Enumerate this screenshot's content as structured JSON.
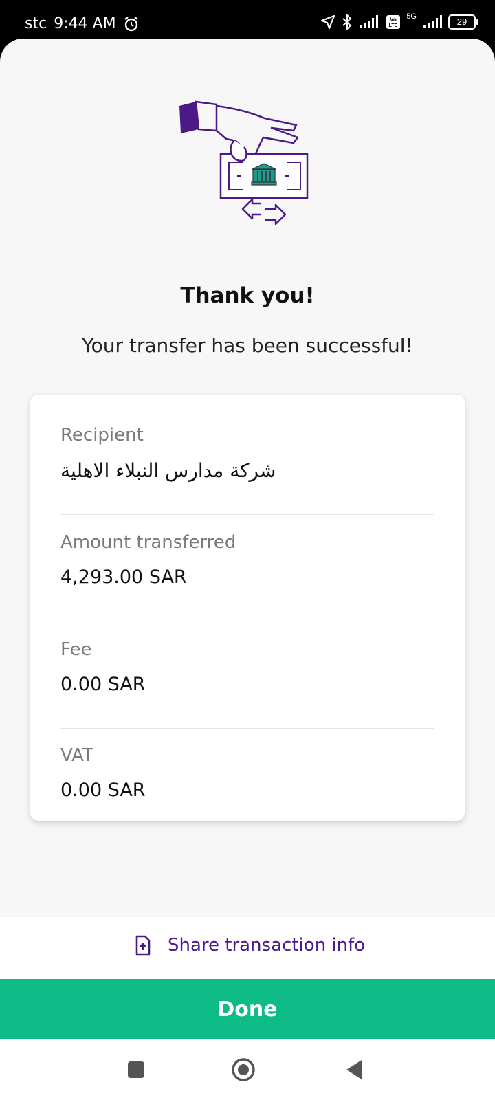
{
  "status_bar": {
    "carrier": "stc",
    "time": "9:44 AM",
    "battery": "29",
    "network": "5G"
  },
  "confirmation": {
    "title": "Thank you!",
    "subtitle": "Your transfer has been successful!"
  },
  "details": [
    {
      "label": "Recipient",
      "value": "شركة مدارس النبلاء الاهلية"
    },
    {
      "label": "Amount transferred",
      "value": "4,293.00 SAR"
    },
    {
      "label": "Fee",
      "value": "0.00 SAR"
    },
    {
      "label": "VAT",
      "value": "0.00 SAR"
    }
  ],
  "actions": {
    "share_label": "Share transaction info",
    "done_label": "Done"
  },
  "colors": {
    "accent": "#4b1a86",
    "done": "#0dbb86",
    "bank_teal": "#1f9b8f"
  },
  "icons": {
    "alarm": "alarm-icon",
    "location": "location-icon",
    "bluetooth": "bluetooth-icon",
    "share": "share-file-icon",
    "illustration": "hand-banknote-illustration"
  }
}
